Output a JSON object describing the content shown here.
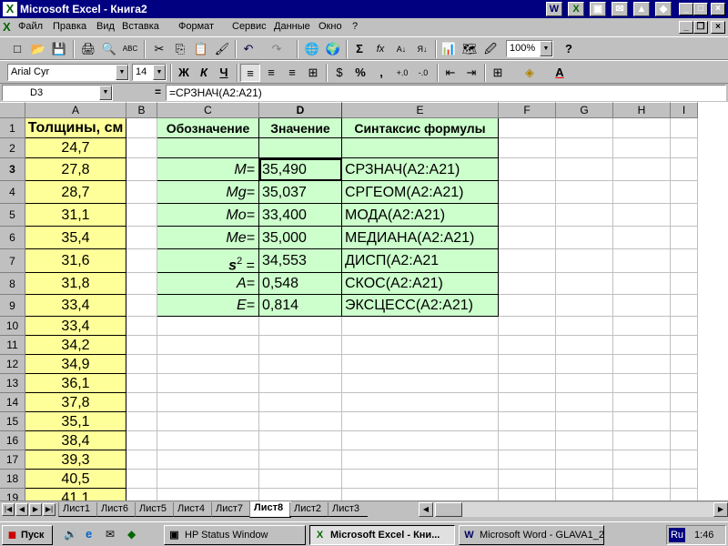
{
  "window": {
    "title": "Microsoft Excel - Книга2",
    "app_icon": "excel-icon",
    "min_label": "_",
    "max_label": "□",
    "close_label": "×",
    "title_shortcuts": [
      "W",
      "X",
      "▣",
      "✉",
      "▲",
      "◆",
      "✓"
    ]
  },
  "menu": {
    "items": [
      "Файл",
      "Правка",
      "Вид",
      "Вставка",
      "Формат",
      "Сервис",
      "Данные",
      "Окно",
      "?"
    ],
    "doc_controls": [
      "_",
      "❐",
      "×"
    ]
  },
  "standard_toolbar": {
    "buttons": [
      "□",
      "📂",
      "💾",
      "🖨",
      "🔍",
      "ABC",
      "✂",
      "⎘",
      "📋",
      "🖌",
      "↶",
      "↷",
      "🌐",
      "🌍",
      "Σ",
      "fx",
      "A↓",
      "Я↓",
      "📊",
      "🗺",
      "🖉"
    ],
    "zoom": "100%",
    "help_icon": "?"
  },
  "formatting_toolbar": {
    "font": "Arial Cyr",
    "size": "14",
    "bold": "Ж",
    "italic": "К",
    "underline": "Ч",
    "align_buttons": [
      "≡",
      "≡",
      "≡",
      "⊞"
    ],
    "number_buttons": [
      "$",
      "%",
      ",",
      "+.0",
      "-.0"
    ],
    "indent_buttons": [
      "⇤",
      "⇥"
    ],
    "border_icon": "⊞",
    "fill_icon": "◈",
    "font_color_icon": "A"
  },
  "formula_bar": {
    "name_box": "D3",
    "eq": "=",
    "formula": "=СРЗНАЧ(A2:A21)"
  },
  "columns": [
    "A",
    "B",
    "C",
    "D",
    "E",
    "F",
    "G",
    "H",
    "I"
  ],
  "rows": [
    "1",
    "2",
    "3",
    "4",
    "5",
    "6",
    "7",
    "8",
    "9",
    "10",
    "11",
    "12",
    "13",
    "14",
    "15",
    "16",
    "17",
    "18",
    "19"
  ],
  "cells": {
    "A": [
      "Толщины, см",
      "24,7",
      "27,8",
      "28,7",
      "31,1",
      "35,4",
      "31,6",
      "31,8",
      "33,4",
      "33,4",
      "34,2",
      "34,9",
      "36,1",
      "37,8",
      "35,1",
      "38,4",
      "39,3",
      "40,5",
      "41,1"
    ],
    "C": [
      "Обозначение",
      "",
      "M=",
      "Mg=",
      "Mo=",
      "Me=",
      "s",
      "A=",
      "E="
    ],
    "C7_sup": "2",
    "C7_tail": " =",
    "D": [
      "Значение",
      "",
      "35,490",
      "35,037",
      "33,400",
      "35,000",
      "34,553",
      "0,548",
      "0,814"
    ],
    "E": [
      "Синтаксис формулы",
      "",
      "СРЗНАЧ(A2:A21)",
      "СРГЕОМ(A2:A21)",
      "МОДА(A2:A21)",
      "МЕДИАНА(A2:A21)",
      "ДИСП(A2:A21",
      "СКОС(A2:A21)",
      "ЭКСЦЕСС(A2:A21)"
    ]
  },
  "sheet_tabs": {
    "nav": [
      "|◀",
      "◀",
      "▶",
      "▶|"
    ],
    "tabs": [
      "Лист1",
      "Лист6",
      "Лист5",
      "Лист4",
      "Лист7",
      "Лист8",
      "Лист2",
      "Лист3"
    ],
    "active": "Лист8"
  },
  "hscroll": {
    "left": "◀",
    "right": "▶"
  },
  "taskbar": {
    "start": "Пуск",
    "quick_launch": [
      "🔊",
      "e",
      "✉",
      "◆"
    ],
    "tasks": [
      {
        "label": "HP Status Window",
        "icon": "▣"
      },
      {
        "label": "Microsoft Excel - Кни...",
        "icon": "X"
      },
      {
        "label": "Microsoft Word - GLAVA1_2",
        "icon": "W"
      }
    ],
    "lang": "Ru",
    "time": "1:46"
  },
  "colors": {
    "yellow": "#ffff99",
    "green": "#ccffcc",
    "title": "#000080"
  }
}
